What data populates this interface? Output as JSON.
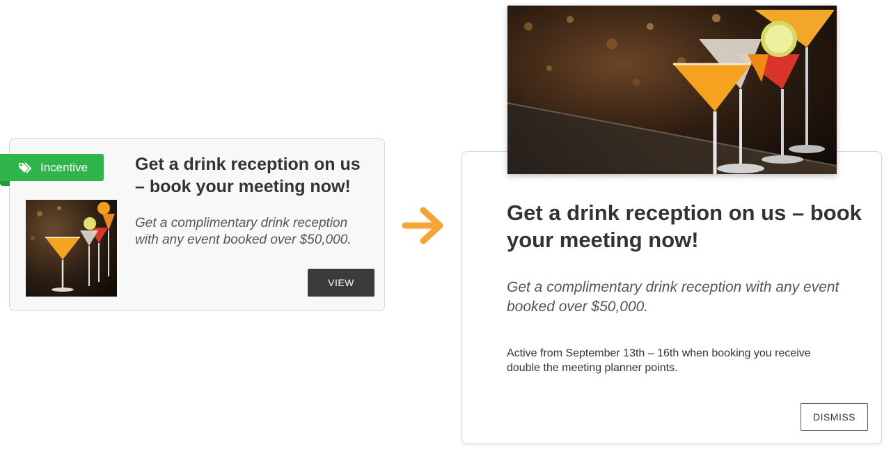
{
  "colors": {
    "accent_green": "#2fb54a",
    "arrow_orange": "#f5a43a",
    "button_dark": "#3b3b3b"
  },
  "small_card": {
    "tag_label": "Incentive",
    "tag_icon": "price-tag-icon",
    "title": "Get a drink reception on us – book your meeting now!",
    "description": "Get a complimentary drink reception with any event booked over $50,000.",
    "view_label": "VIEW"
  },
  "transition": {
    "arrow_icon": "arrow-right-icon"
  },
  "large_card": {
    "title": "Get a drink reception on us – book your meeting now!",
    "description": "Get a complimentary drink reception with any event booked over $50,000.",
    "note": "Active from September 13th – 16th when booking you receive double the meeting planner points.",
    "dismiss_label": "DISMISS"
  }
}
